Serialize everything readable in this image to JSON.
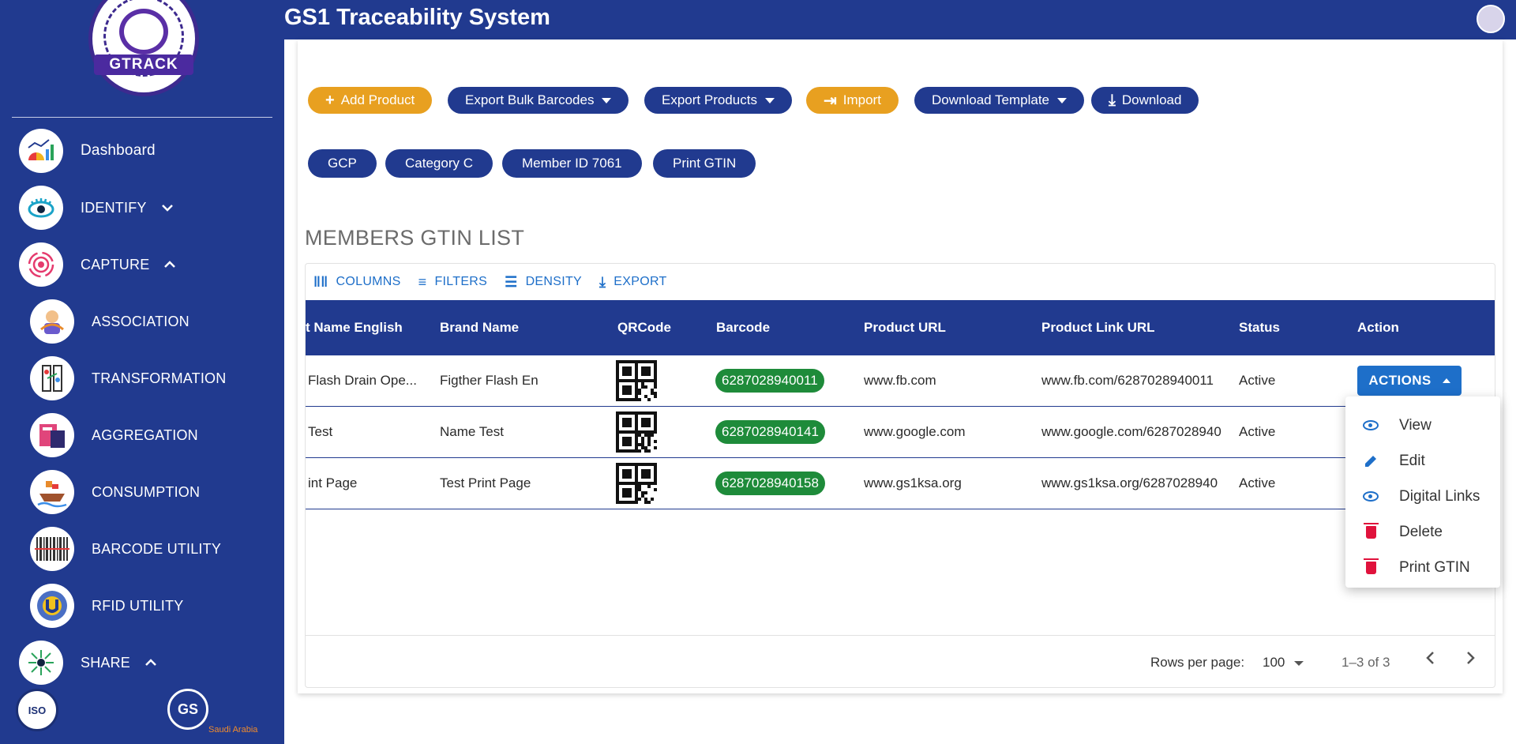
{
  "app": {
    "title": "GS1 Traceability System",
    "logo_text": "GTRACK"
  },
  "sidebar": {
    "items": [
      {
        "label": "Dashboard",
        "icon": "dashboard-icon"
      },
      {
        "label": "IDENTIFY",
        "icon": "eye-icon",
        "chevron": "down"
      },
      {
        "label": "CAPTURE",
        "icon": "signal-icon",
        "chevron": "up"
      },
      {
        "label": "ASSOCIATION",
        "icon": "association-icon"
      },
      {
        "label": "TRANSFORMATION",
        "icon": "transformation-icon"
      },
      {
        "label": "AGGREGATION",
        "icon": "aggregation-icon"
      },
      {
        "label": "CONSUMPTION",
        "icon": "consumption-icon"
      },
      {
        "label": "BARCODE UTILITY",
        "icon": "barcode-icon"
      },
      {
        "label": "RFID UTILITY",
        "icon": "rfid-icon"
      },
      {
        "label": "SHARE",
        "icon": "share-icon",
        "chevron": "up"
      }
    ],
    "iso_text": "ISO",
    "gs1_text": "GS",
    "gs1_region": "Saudi Arabia"
  },
  "toolbar_buttons": {
    "add_product": "Add Product",
    "export_bulk": "Export Bulk Barcodes",
    "export_products": "Export Products",
    "import": "Import",
    "download_template": "Download Template",
    "download": "Download"
  },
  "chips": [
    "GCP",
    "Category C",
    "Member ID 7061",
    "Print GTIN"
  ],
  "list_title": "MEMBERS GTIN LIST",
  "grid_toolbar": {
    "columns": "COLUMNS",
    "filters": "FILTERS",
    "density": "DENSITY",
    "export": "EXPORT"
  },
  "table": {
    "headers": [
      "t Name English",
      "Brand Name",
      "QRCode",
      "Barcode",
      "Product URL",
      "Product Link URL",
      "Status",
      "Action"
    ],
    "rows": [
      {
        "name": "Flash Drain Ope...",
        "brand": "Figther Flash En",
        "barcode": "6287028940011",
        "product_url": "www.fb.com",
        "link_url": "www.fb.com/6287028940011",
        "status": "Active"
      },
      {
        "name": "Test",
        "brand": "Name Test",
        "barcode": "6287028940141",
        "product_url": "www.google.com",
        "link_url": "www.google.com/6287028940",
        "status": "Active"
      },
      {
        "name": "int Page",
        "brand": "Test Print Page",
        "barcode": "6287028940158",
        "product_url": "www.gs1ksa.org",
        "link_url": "www.gs1ksa.org/6287028940",
        "status": "Active"
      }
    ],
    "actions_label": "ACTIONS"
  },
  "menu": {
    "items": [
      {
        "label": "View",
        "icon": "view-icon"
      },
      {
        "label": "Edit",
        "icon": "edit-icon"
      },
      {
        "label": "Digital Links",
        "icon": "view-icon"
      },
      {
        "label": "Delete",
        "icon": "trash-icon"
      },
      {
        "label": "Print GTIN",
        "icon": "trash-icon"
      }
    ]
  },
  "pagination": {
    "rows_per_page_label": "Rows per page:",
    "rows_per_page": "100",
    "range": "1–3 of 3"
  }
}
